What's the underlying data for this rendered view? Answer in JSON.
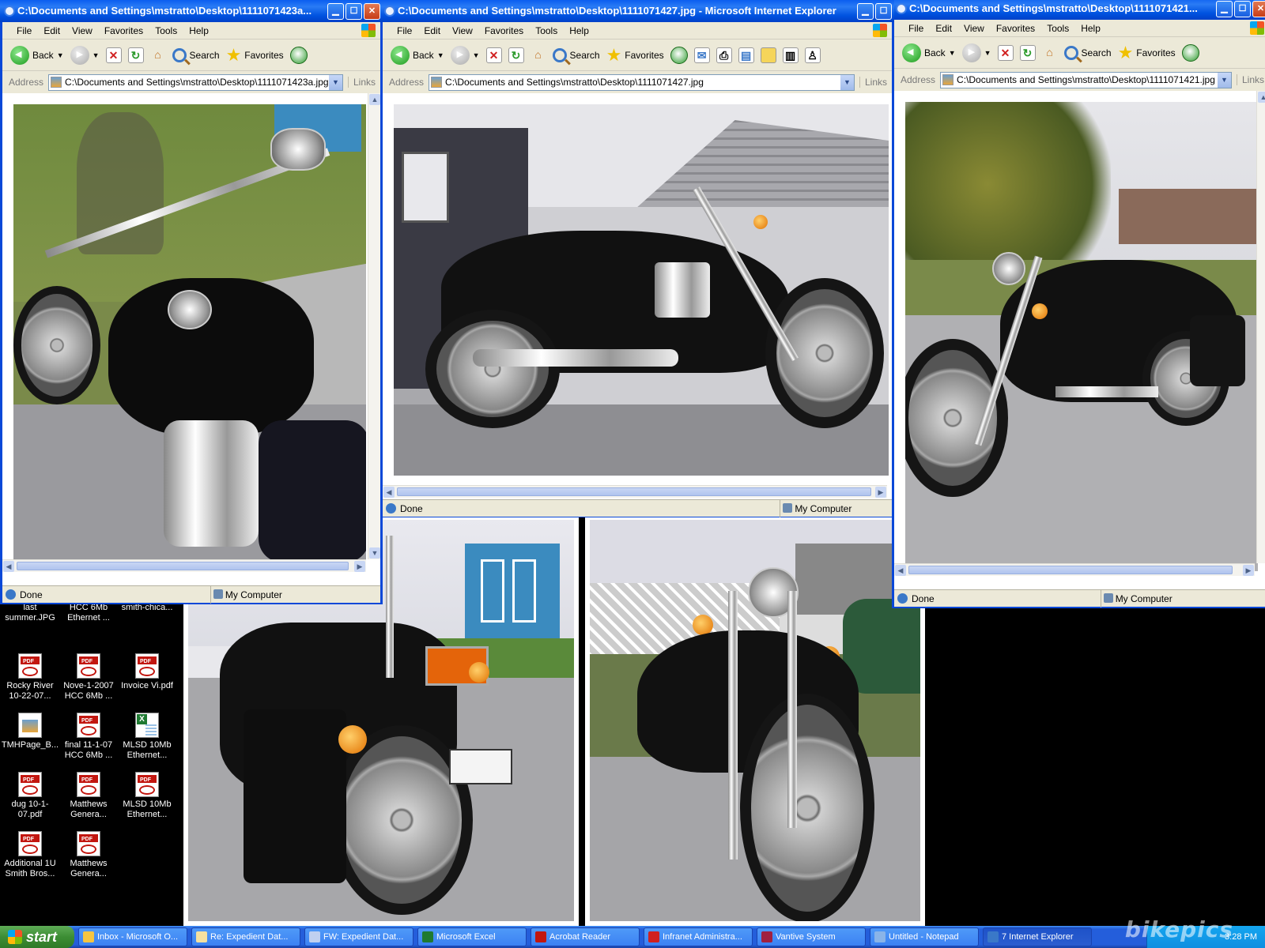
{
  "desktop": {
    "icons": [
      {
        "label": "last summer.JPG",
        "type": "jpg"
      },
      {
        "label": "HCC 6Mb Ethernet ...",
        "type": "pdf"
      },
      {
        "label": "smith-chica...",
        "type": "gen"
      },
      {
        "label": "Rocky River 10-22-07...",
        "type": "pdf"
      },
      {
        "label": "Nove-1-2007 HCC 6Mb ...",
        "type": "pdf"
      },
      {
        "label": "Invoice Vi.pdf",
        "type": "pdf"
      },
      {
        "label": "TMHPage_B...",
        "type": "jpg"
      },
      {
        "label": "final 11-1-07 HCC 6Mb ...",
        "type": "pdf"
      },
      {
        "label": "MLSD 10Mb Ethernet...",
        "type": "xls"
      },
      {
        "label": "dug 10-1-07.pdf",
        "type": "pdf"
      },
      {
        "label": "Matthews Genera...",
        "type": "pdf"
      },
      {
        "label": "MLSD 10Mb Ethernet...",
        "type": "pdf"
      },
      {
        "label": "Additional 1U Smith Bros...",
        "type": "pdf"
      },
      {
        "label": "Matthews Genera...",
        "type": "pdf"
      }
    ]
  },
  "ie": {
    "menu": [
      "File",
      "Edit",
      "View",
      "Favorites",
      "Tools",
      "Help"
    ],
    "back": "Back",
    "search": "Search",
    "favorites": "Favorites",
    "address_label": "Address",
    "links": "Links",
    "status_done": "Done",
    "zone": "My Computer"
  },
  "windows": [
    {
      "title": "C:\\Documents and Settings\\mstratto\\Desktop\\1111071423a...",
      "address": "C:\\Documents and Settings\\mstratto\\Desktop\\1111071423a.jpg"
    },
    {
      "title": "C:\\Documents and Settings\\mstratto\\Desktop\\1111071427.jpg - Microsoft Internet Explorer",
      "address": "C:\\Documents and Settings\\mstratto\\Desktop\\1111071427.jpg"
    },
    {
      "title": "C:\\Documents and Settings\\mstratto\\Desktop\\1111071421...",
      "address": "C:\\Documents and Settings\\mstratto\\Desktop\\1111071421.jpg"
    }
  ],
  "taskbar": {
    "start": "start",
    "tasks": [
      {
        "label": "Inbox - Microsoft O...",
        "color": "#f5c542"
      },
      {
        "label": "Re: Expedient Dat...",
        "color": "#f5e0a0"
      },
      {
        "label": "FW: Expedient Dat...",
        "color": "#c0d0f0"
      },
      {
        "label": "Microsoft Excel",
        "color": "#1f7a32"
      },
      {
        "label": "Acrobat Reader",
        "color": "#c2160f"
      },
      {
        "label": "Infranet Administra...",
        "color": "#d02020"
      },
      {
        "label": "Vantive System",
        "color": "#a02040"
      },
      {
        "label": "Untitled - Notepad",
        "color": "#8ab4e8"
      },
      {
        "label": "7 Internet Explorer",
        "color": "#3a78c8"
      }
    ],
    "clock": "3:28 PM"
  },
  "watermark": "bikepics"
}
